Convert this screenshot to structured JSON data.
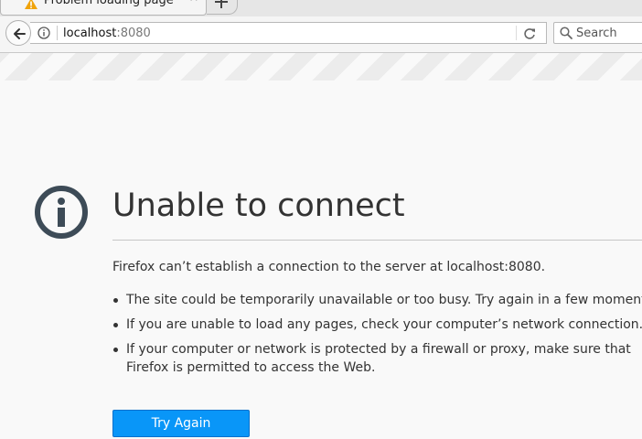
{
  "tab": {
    "title": "Problem loading page",
    "icon": "warning-icon",
    "close_glyph": "×"
  },
  "navbar": {
    "url_host": "localhost",
    "url_port": ":8080",
    "search_placeholder": "Search"
  },
  "error_page": {
    "icon": "info-circle-icon",
    "title": "Unable to connect",
    "message": "Firefox can’t establish a connection to the server at localhost:8080.",
    "bullets": [
      "The site could be temporarily unavailable or too busy. Try again in a few moments.",
      "If you are unable to load any pages, check your computer’s network connection.",
      "If your computer or network is protected by a firewall or proxy, make sure that Firefox is permitted to access the Web."
    ],
    "button_label": "Try Again"
  },
  "colors": {
    "button_blue": "#0996f8",
    "warning_orange": "#f0a30a",
    "icon_dark": "#3d4b57"
  }
}
